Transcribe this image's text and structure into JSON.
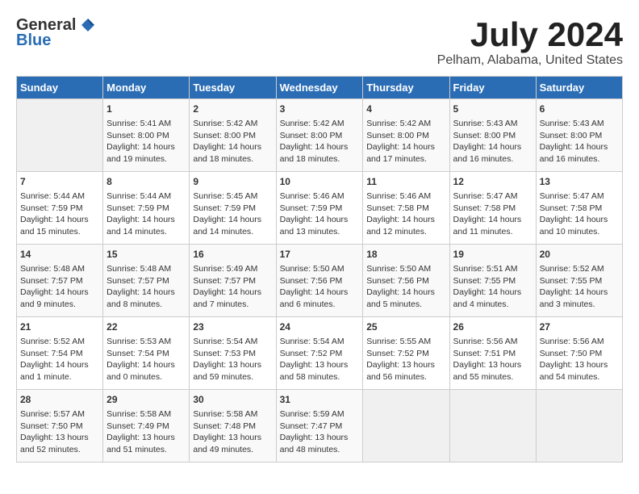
{
  "header": {
    "logo_general": "General",
    "logo_blue": "Blue",
    "title": "July 2024",
    "location": "Pelham, Alabama, United States"
  },
  "days_of_week": [
    "Sunday",
    "Monday",
    "Tuesday",
    "Wednesday",
    "Thursday",
    "Friday",
    "Saturday"
  ],
  "weeks": [
    [
      {
        "day": "",
        "content": ""
      },
      {
        "day": "1",
        "content": "Sunrise: 5:41 AM\nSunset: 8:00 PM\nDaylight: 14 hours\nand 19 minutes."
      },
      {
        "day": "2",
        "content": "Sunrise: 5:42 AM\nSunset: 8:00 PM\nDaylight: 14 hours\nand 18 minutes."
      },
      {
        "day": "3",
        "content": "Sunrise: 5:42 AM\nSunset: 8:00 PM\nDaylight: 14 hours\nand 18 minutes."
      },
      {
        "day": "4",
        "content": "Sunrise: 5:42 AM\nSunset: 8:00 PM\nDaylight: 14 hours\nand 17 minutes."
      },
      {
        "day": "5",
        "content": "Sunrise: 5:43 AM\nSunset: 8:00 PM\nDaylight: 14 hours\nand 16 minutes."
      },
      {
        "day": "6",
        "content": "Sunrise: 5:43 AM\nSunset: 8:00 PM\nDaylight: 14 hours\nand 16 minutes."
      }
    ],
    [
      {
        "day": "7",
        "content": "Sunrise: 5:44 AM\nSunset: 7:59 PM\nDaylight: 14 hours\nand 15 minutes."
      },
      {
        "day": "8",
        "content": "Sunrise: 5:44 AM\nSunset: 7:59 PM\nDaylight: 14 hours\nand 14 minutes."
      },
      {
        "day": "9",
        "content": "Sunrise: 5:45 AM\nSunset: 7:59 PM\nDaylight: 14 hours\nand 14 minutes."
      },
      {
        "day": "10",
        "content": "Sunrise: 5:46 AM\nSunset: 7:59 PM\nDaylight: 14 hours\nand 13 minutes."
      },
      {
        "day": "11",
        "content": "Sunrise: 5:46 AM\nSunset: 7:58 PM\nDaylight: 14 hours\nand 12 minutes."
      },
      {
        "day": "12",
        "content": "Sunrise: 5:47 AM\nSunset: 7:58 PM\nDaylight: 14 hours\nand 11 minutes."
      },
      {
        "day": "13",
        "content": "Sunrise: 5:47 AM\nSunset: 7:58 PM\nDaylight: 14 hours\nand 10 minutes."
      }
    ],
    [
      {
        "day": "14",
        "content": "Sunrise: 5:48 AM\nSunset: 7:57 PM\nDaylight: 14 hours\nand 9 minutes."
      },
      {
        "day": "15",
        "content": "Sunrise: 5:48 AM\nSunset: 7:57 PM\nDaylight: 14 hours\nand 8 minutes."
      },
      {
        "day": "16",
        "content": "Sunrise: 5:49 AM\nSunset: 7:57 PM\nDaylight: 14 hours\nand 7 minutes."
      },
      {
        "day": "17",
        "content": "Sunrise: 5:50 AM\nSunset: 7:56 PM\nDaylight: 14 hours\nand 6 minutes."
      },
      {
        "day": "18",
        "content": "Sunrise: 5:50 AM\nSunset: 7:56 PM\nDaylight: 14 hours\nand 5 minutes."
      },
      {
        "day": "19",
        "content": "Sunrise: 5:51 AM\nSunset: 7:55 PM\nDaylight: 14 hours\nand 4 minutes."
      },
      {
        "day": "20",
        "content": "Sunrise: 5:52 AM\nSunset: 7:55 PM\nDaylight: 14 hours\nand 3 minutes."
      }
    ],
    [
      {
        "day": "21",
        "content": "Sunrise: 5:52 AM\nSunset: 7:54 PM\nDaylight: 14 hours\nand 1 minute."
      },
      {
        "day": "22",
        "content": "Sunrise: 5:53 AM\nSunset: 7:54 PM\nDaylight: 14 hours\nand 0 minutes."
      },
      {
        "day": "23",
        "content": "Sunrise: 5:54 AM\nSunset: 7:53 PM\nDaylight: 13 hours\nand 59 minutes."
      },
      {
        "day": "24",
        "content": "Sunrise: 5:54 AM\nSunset: 7:52 PM\nDaylight: 13 hours\nand 58 minutes."
      },
      {
        "day": "25",
        "content": "Sunrise: 5:55 AM\nSunset: 7:52 PM\nDaylight: 13 hours\nand 56 minutes."
      },
      {
        "day": "26",
        "content": "Sunrise: 5:56 AM\nSunset: 7:51 PM\nDaylight: 13 hours\nand 55 minutes."
      },
      {
        "day": "27",
        "content": "Sunrise: 5:56 AM\nSunset: 7:50 PM\nDaylight: 13 hours\nand 54 minutes."
      }
    ],
    [
      {
        "day": "28",
        "content": "Sunrise: 5:57 AM\nSunset: 7:50 PM\nDaylight: 13 hours\nand 52 minutes."
      },
      {
        "day": "29",
        "content": "Sunrise: 5:58 AM\nSunset: 7:49 PM\nDaylight: 13 hours\nand 51 minutes."
      },
      {
        "day": "30",
        "content": "Sunrise: 5:58 AM\nSunset: 7:48 PM\nDaylight: 13 hours\nand 49 minutes."
      },
      {
        "day": "31",
        "content": "Sunrise: 5:59 AM\nSunset: 7:47 PM\nDaylight: 13 hours\nand 48 minutes."
      },
      {
        "day": "",
        "content": ""
      },
      {
        "day": "",
        "content": ""
      },
      {
        "day": "",
        "content": ""
      }
    ]
  ]
}
